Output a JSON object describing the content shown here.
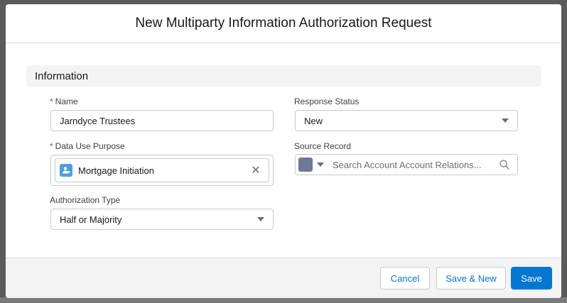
{
  "modal": {
    "title": "New Multiparty Information Authorization Request"
  },
  "section": {
    "title": "Information"
  },
  "fields": {
    "name": {
      "label": "Name",
      "required_marker": "*",
      "value": "Jarndyce Trustees"
    },
    "data_use_purpose": {
      "label": "Data Use Purpose",
      "required_marker": "*",
      "selected": "Mortgage Initiation",
      "clear_glyph": "✕"
    },
    "authorization_type": {
      "label": "Authorization Type",
      "value": "Half or Majority"
    },
    "response_status": {
      "label": "Response Status",
      "value": "New"
    },
    "source_record": {
      "label": "Source Record",
      "placeholder": "Search Account Account Relations..."
    }
  },
  "footer": {
    "cancel_label": "Cancel",
    "save_new_label": "Save & New",
    "save_label": "Save"
  },
  "colors": {
    "brand": "#0176d3",
    "required": "#c23934",
    "section_bg": "#f3f3f3",
    "object_icon": "#6d7a96",
    "pill_icon": "#4b9ee0"
  },
  "icons": {
    "pill": "data-use-purpose-icon",
    "clear": "close-icon",
    "search": "search-icon",
    "dropdown": "chevron-down-icon"
  }
}
